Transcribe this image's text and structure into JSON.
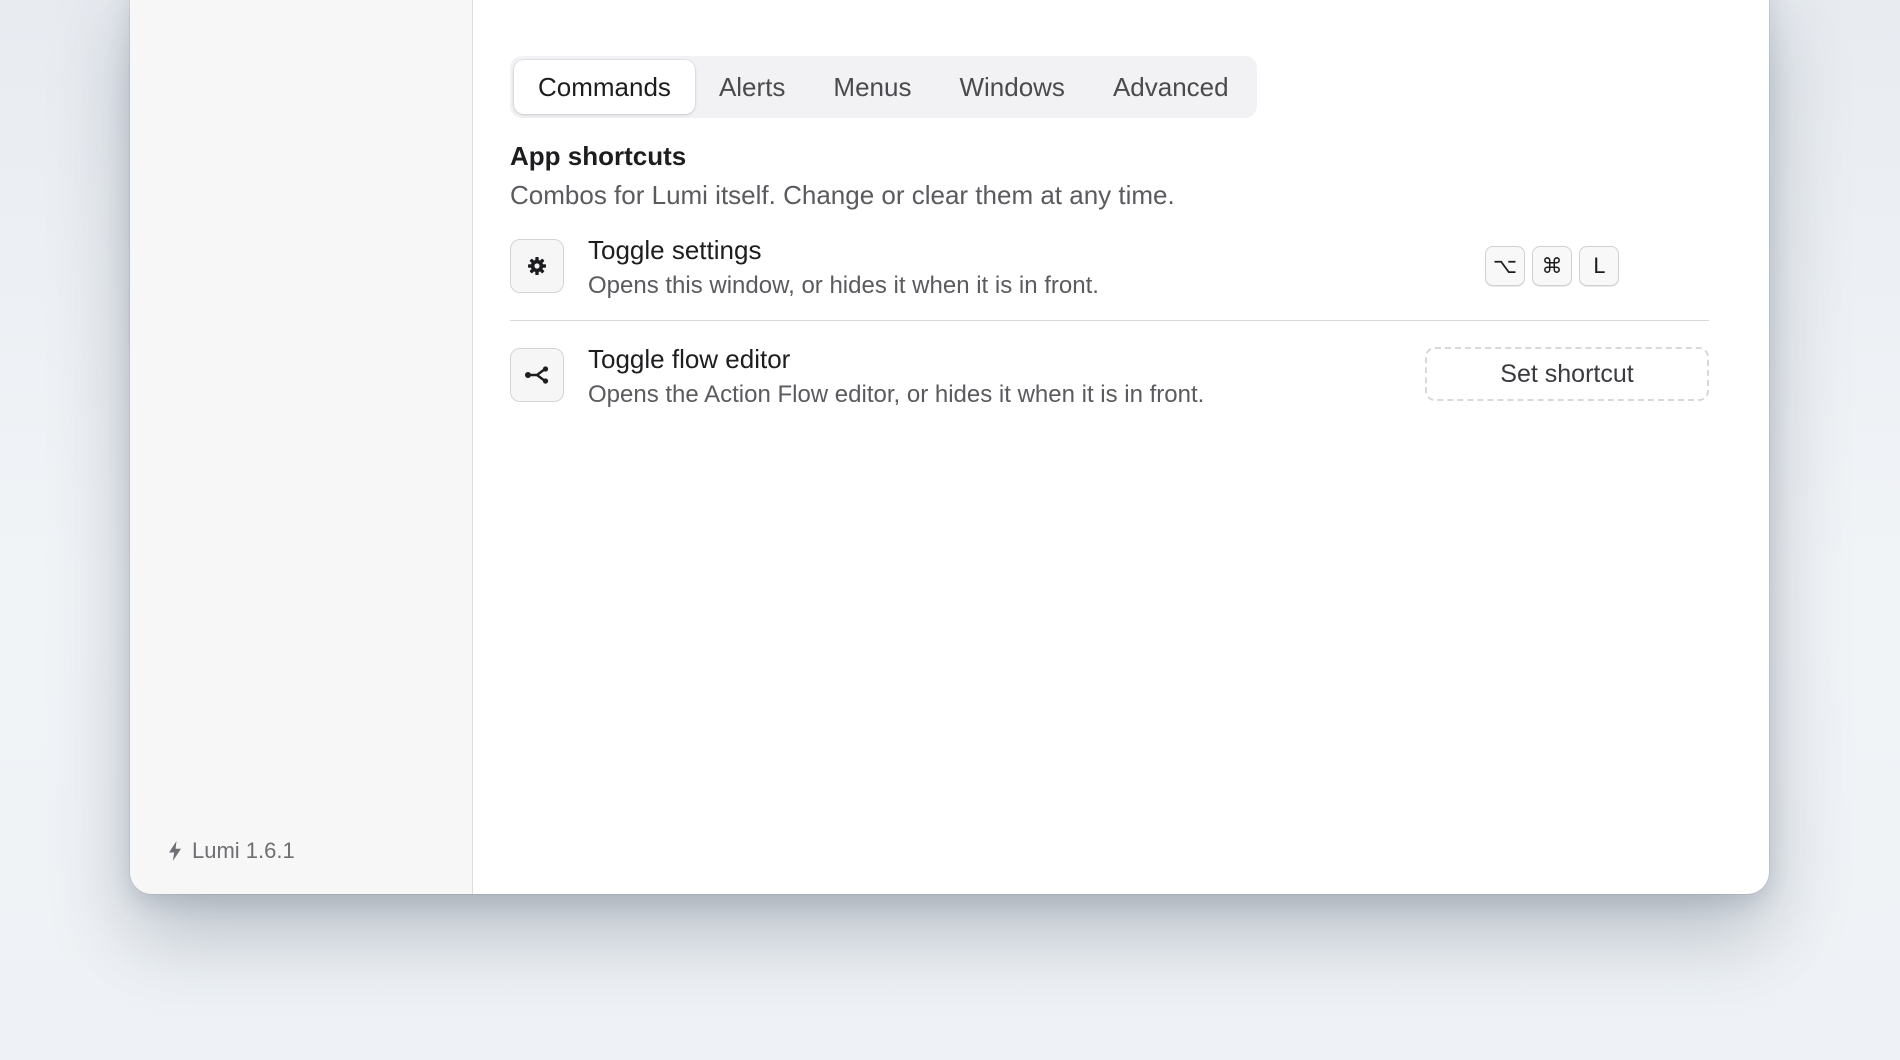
{
  "tabs": [
    {
      "label": "Commands",
      "active": true
    },
    {
      "label": "Alerts",
      "active": false
    },
    {
      "label": "Menus",
      "active": false
    },
    {
      "label": "Windows",
      "active": false
    },
    {
      "label": "Advanced",
      "active": false
    }
  ],
  "section": {
    "title": "App shortcuts",
    "description": "Combos for Lumi itself. Change or clear them at any time."
  },
  "shortcuts": [
    {
      "icon": "gear-icon",
      "title": "Toggle settings",
      "description": "Opens this window, or hides it when it is in front.",
      "keys": [
        "⌥",
        "⌘",
        "L"
      ]
    },
    {
      "icon": "flow-icon",
      "title": "Toggle flow editor",
      "description": "Opens the Action Flow editor, or hides it when it is in front.",
      "button_label": "Set shortcut"
    }
  ],
  "sidebar": {
    "footer_icon": "bolt-icon",
    "version_label": "Lumi 1.6.1"
  }
}
